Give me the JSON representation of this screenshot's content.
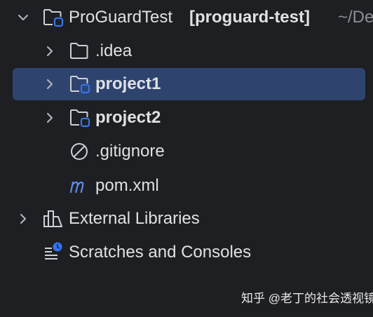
{
  "colors": {
    "background": "#1e1f22",
    "selection": "#2e436e",
    "text": "#dfe1e5",
    "dim_text": "#8b8e94",
    "module_accent": "#3574f0",
    "maven_icon": "#5d8cf0"
  },
  "tree": {
    "root": {
      "name": "ProGuardTest",
      "module": "[proguard-test]",
      "path": "~/De",
      "icon": "module-folder-icon",
      "expanded": true
    },
    "items": [
      {
        "label": ".idea",
        "icon": "folder-icon",
        "expandable": true,
        "bold": false
      },
      {
        "label": "project1",
        "icon": "module-folder-icon",
        "expandable": true,
        "bold": true,
        "selected": true
      },
      {
        "label": "project2",
        "icon": "module-folder-icon",
        "expandable": true,
        "bold": true
      },
      {
        "label": ".gitignore",
        "icon": "ignore-file-icon",
        "expandable": false,
        "bold": false
      },
      {
        "label": "pom.xml",
        "icon": "maven-file-icon",
        "expandable": false,
        "bold": false
      }
    ],
    "external_libraries": {
      "label": "External Libraries",
      "icon": "libraries-icon",
      "expandable": true
    },
    "scratches": {
      "label": "Scratches and Consoles",
      "icon": "scratches-icon",
      "expandable": false
    }
  },
  "watermark": "知乎 @老丁的社会透视镜"
}
